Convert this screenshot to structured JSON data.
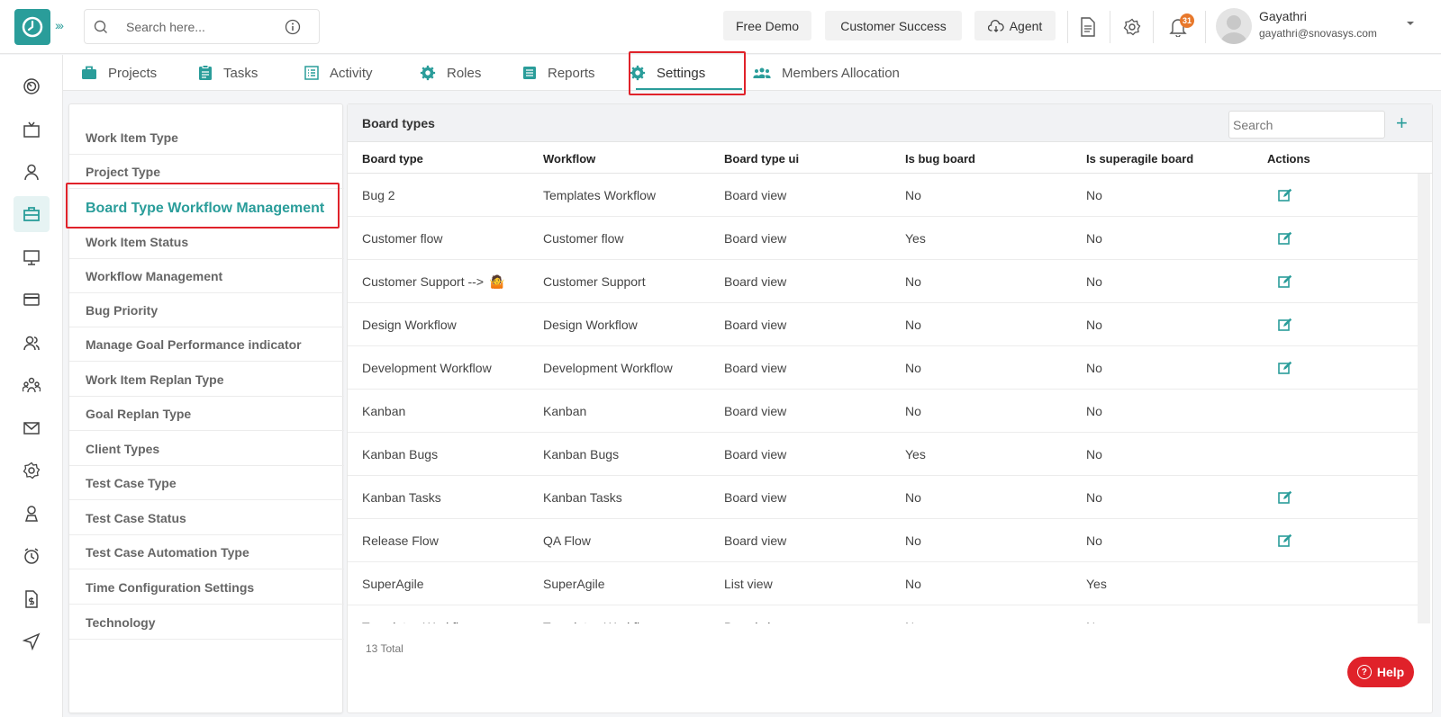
{
  "header": {
    "search_placeholder": "Search here...",
    "buttons": {
      "free_demo": "Free Demo",
      "customer_success": "Customer Success",
      "agent": "Agent"
    },
    "notification_count": "31",
    "user": {
      "name": "Gayathri",
      "email": "gayathri@snovasys.com"
    }
  },
  "tabs": [
    {
      "label": "Projects",
      "icon": "briefcase-icon"
    },
    {
      "label": "Tasks",
      "icon": "clipboard-icon"
    },
    {
      "label": "Activity",
      "icon": "list-icon"
    },
    {
      "label": "Roles",
      "icon": "gear-icon"
    },
    {
      "label": "Reports",
      "icon": "document-icon"
    },
    {
      "label": "Settings",
      "icon": "gear-icon"
    },
    {
      "label": "Members Allocation",
      "icon": "users-icon"
    }
  ],
  "active_tab": "Settings",
  "settings_menu": [
    "Work Item Type",
    "Project Type",
    "Board Type Workflow Management",
    "Work Item Status",
    "Workflow Management",
    "Bug Priority",
    "Manage Goal Performance indicator",
    "Work Item Replan Type",
    "Goal Replan Type",
    "Client Types",
    "Test Case Type",
    "Test Case Status",
    "Test Case Automation Type",
    "Time Configuration Settings",
    "Technology"
  ],
  "active_setting": "Board Type Workflow Management",
  "panel": {
    "title": "Board types",
    "search_placeholder": "Search",
    "columns": [
      "Board type",
      "Workflow",
      "Board type ui",
      "Is bug board",
      "Is superagile board",
      "Actions"
    ],
    "rows": [
      {
        "board_type": "Bug 2",
        "workflow": "Templates Workflow",
        "ui": "Board view",
        "bug": "No",
        "superagile": "No",
        "editable": true
      },
      {
        "board_type": "Customer flow",
        "workflow": "Customer flow",
        "ui": "Board view",
        "bug": "Yes",
        "superagile": "No",
        "editable": true
      },
      {
        "board_type": "Customer Support -->",
        "emoji": "🤷",
        "workflow": "Customer Support",
        "ui": "Board view",
        "bug": "No",
        "superagile": "No",
        "editable": true
      },
      {
        "board_type": "Design Workflow",
        "workflow": "Design Workflow",
        "ui": "Board view",
        "bug": "No",
        "superagile": "No",
        "editable": true
      },
      {
        "board_type": "Development Workflow",
        "workflow": "Development Workflow",
        "ui": "Board view",
        "bug": "No",
        "superagile": "No",
        "editable": true
      },
      {
        "board_type": "Kanban",
        "workflow": "Kanban",
        "ui": "Board view",
        "bug": "No",
        "superagile": "No",
        "editable": false
      },
      {
        "board_type": "Kanban Bugs",
        "workflow": "Kanban Bugs",
        "ui": "Board view",
        "bug": "Yes",
        "superagile": "No",
        "editable": false
      },
      {
        "board_type": "Kanban Tasks",
        "workflow": "Kanban Tasks",
        "ui": "Board view",
        "bug": "No",
        "superagile": "No",
        "editable": true
      },
      {
        "board_type": "Release Flow",
        "workflow": "QA Flow",
        "ui": "Board view",
        "bug": "No",
        "superagile": "No",
        "editable": true
      },
      {
        "board_type": "SuperAgile",
        "workflow": "SuperAgile",
        "ui": "List view",
        "bug": "No",
        "superagile": "Yes",
        "editable": false
      },
      {
        "board_type": "Templates Workflow",
        "workflow": "Templates Workflow",
        "ui": "Board view",
        "bug": "No",
        "superagile": "No",
        "editable": false
      }
    ],
    "total": "13 Total"
  },
  "help_label": "Help",
  "colors": {
    "accent": "#2a9d9a",
    "highlight": "#e0222a"
  }
}
